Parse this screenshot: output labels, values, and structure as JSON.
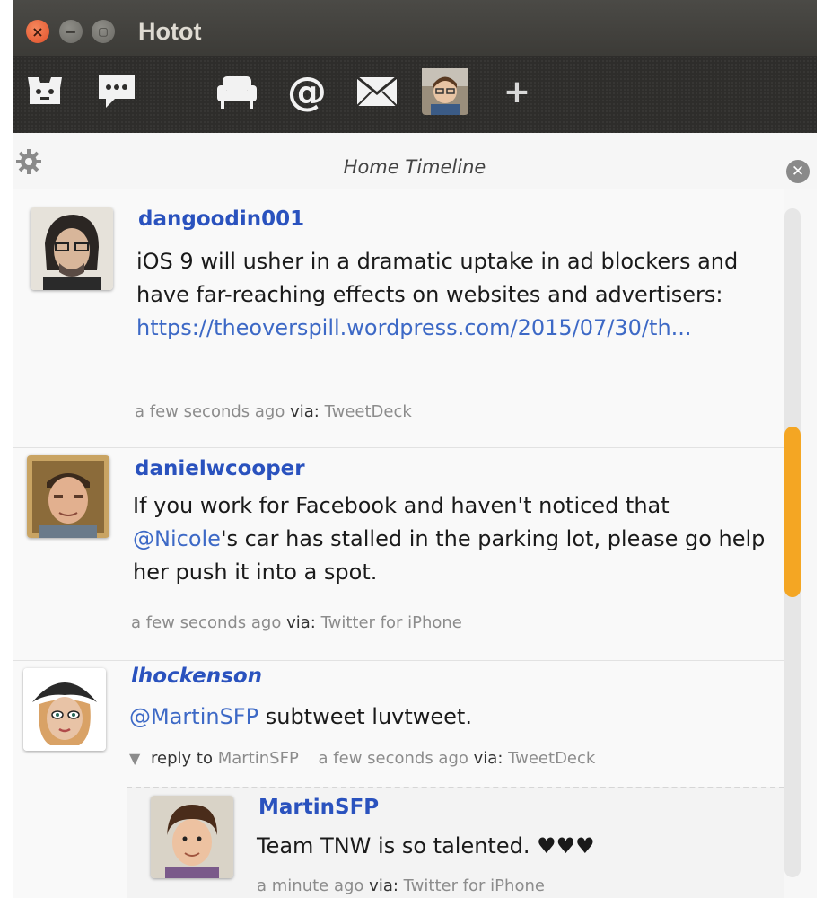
{
  "window": {
    "title": "Hotot",
    "close_glyph": "×",
    "min_glyph": "−",
    "max_glyph": "▢"
  },
  "toolbar": {
    "items": [
      {
        "name": "hotot-logo-icon"
      },
      {
        "name": "compose-icon"
      },
      {
        "name": "home-timeline-icon",
        "active": true
      },
      {
        "name": "mentions-icon"
      },
      {
        "name": "messages-icon"
      },
      {
        "name": "profile-avatar"
      },
      {
        "name": "add-column-icon"
      }
    ],
    "mention_glyph": "@",
    "add_glyph": "+"
  },
  "column": {
    "title": "Home Timeline",
    "close_glyph": "✕"
  },
  "tweets": [
    {
      "username": "dangoodin001",
      "text": "iOS 9 will usher in a dramatic uptake in ad blockers and have far-reaching effects on websites and advertisers:",
      "link": "https://theoverspill.wordpress.com/2015/07/30/th...",
      "time": "a few seconds ago",
      "via_label": "via:",
      "source": "TweetDeck"
    },
    {
      "username": "danielwcooper",
      "text_a": "If you work for Facebook and haven't noticed that",
      "mention": "@Nicole",
      "text_b": "'s car has stalled in the parking lot, please go help her push it into a spot.",
      "time": "a few seconds ago",
      "via_label": "via:",
      "source": "Twitter for iPhone"
    },
    {
      "username": "lhockenson",
      "mention": "@MartinSFP",
      "text": " subtweet luvtweet.",
      "reply_arrow": "▼",
      "reply_label": "reply to",
      "reply_to": "MartinSFP",
      "time": "a few seconds ago",
      "via_label": "via:",
      "source": "TweetDeck"
    }
  ],
  "reply": {
    "username": "MartinSFP",
    "text": "Team TNW is so talented. ♥♥♥",
    "time": "a minute ago",
    "via_label": "via:",
    "source": "Twitter for iPhone"
  },
  "colors": {
    "accent": "#2a52be",
    "scroll_thumb": "#f4a623",
    "active_tab": "#5a4bd6"
  }
}
